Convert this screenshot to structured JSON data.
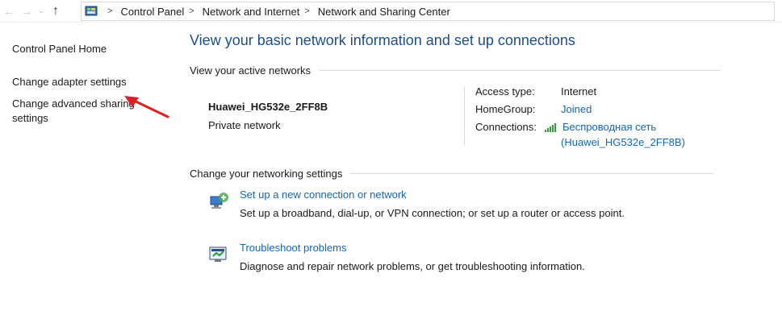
{
  "nav": {
    "back_icon": "←",
    "forward_icon": "→",
    "recent_icon": "⌄",
    "up_icon": "↑"
  },
  "breadcrumb": {
    "separator": ">",
    "items": [
      "Control Panel",
      "Network and Internet",
      "Network and Sharing Center"
    ]
  },
  "sidebar": {
    "home": "Control Panel Home",
    "adapter": "Change adapter settings",
    "sharing": "Change advanced sharing settings"
  },
  "main": {
    "title": "View your basic network information and set up connections",
    "active_networks_heading": "View your active networks",
    "network": {
      "name": "Huawei_HG532e_2FF8B",
      "category": "Private network"
    },
    "properties": {
      "access_type_label": "Access type:",
      "access_type_value": "Internet",
      "homegroup_label": "HomeGroup:",
      "homegroup_value": "Joined",
      "connections_label": "Connections:",
      "connections_value_line1": "Беспроводная сеть",
      "connections_value_line2": "(Huawei_HG532e_2FF8B)"
    },
    "change_settings_heading": "Change your networking settings",
    "tasks": [
      {
        "link": "Set up a new connection or network",
        "desc": "Set up a broadband, dial-up, or VPN connection; or set up a router or access point."
      },
      {
        "link": "Troubleshoot problems",
        "desc": "Diagnose and repair network problems, or get troubleshooting information."
      }
    ]
  },
  "colors": {
    "title": "#1e4e8c",
    "link": "#1366b8",
    "annotation_arrow": "#e02020"
  }
}
